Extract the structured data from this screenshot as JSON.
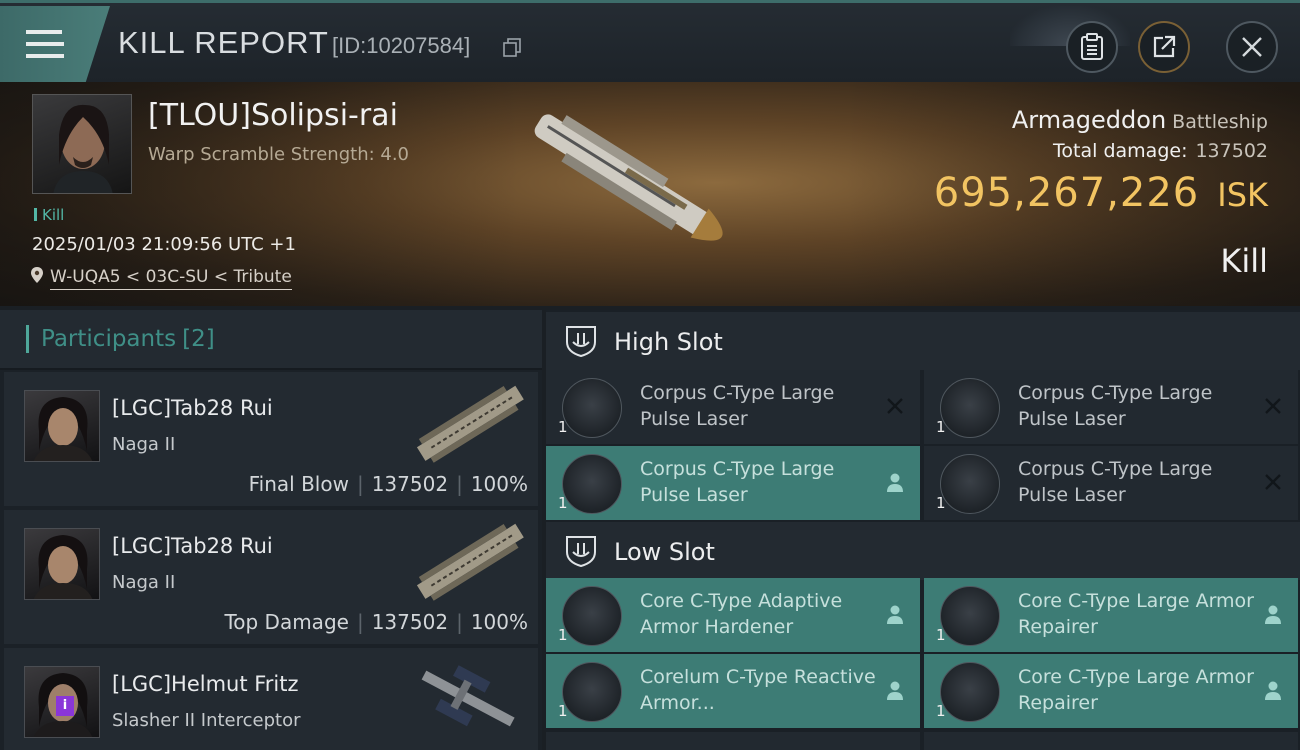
{
  "header": {
    "title": "KILL REPORT",
    "report_id": "[ID:10207584]"
  },
  "victim": {
    "name": "[TLOU]Solipsi-rai",
    "warp_scramble": "Warp Scramble Strength: 4.0",
    "tag": "Kill",
    "datetime": "2025/01/03 21:09:56 UTC +1",
    "location": "W-UQA5 < 03C-SU < Tribute",
    "ship_name": "Armageddon",
    "ship_class": "Battleship",
    "total_damage_label": "Total damage:",
    "total_damage": "137502",
    "isk_value": "695,267,226",
    "isk_unit": "ISK",
    "result": "Kill"
  },
  "participants": {
    "label": "Participants",
    "count": "[2]",
    "list": [
      {
        "name": "[LGC]Tab28 Rui",
        "ship": "Naga II",
        "role": "Final Blow",
        "damage": "137502",
        "percent": "100%"
      },
      {
        "name": "[LGC]Tab28 Rui",
        "ship": "Naga II",
        "role": "Top Damage",
        "damage": "137502",
        "percent": "100%"
      },
      {
        "name": "[LGC]Helmut Fritz",
        "ship": "Slasher II Interceptor",
        "badge": "i"
      }
    ]
  },
  "fitting": {
    "high_slot": {
      "label": "High Slot",
      "modules": [
        {
          "name": "Corpus C-Type Large Pulse Laser",
          "qty": "1",
          "state": "destroyed"
        },
        {
          "name": "Corpus C-Type Large Pulse Laser",
          "qty": "1",
          "state": "destroyed"
        },
        {
          "name": "Corpus C-Type Large Pulse Laser",
          "qty": "1",
          "state": "dropped"
        },
        {
          "name": "Corpus C-Type Large Pulse Laser",
          "qty": "1",
          "state": "destroyed"
        }
      ]
    },
    "low_slot": {
      "label": "Low Slot",
      "modules": [
        {
          "name": "Core C-Type Adaptive Armor Hardener",
          "qty": "1",
          "state": "dropped"
        },
        {
          "name": "Core C-Type Large Armor Repairer",
          "qty": "1",
          "state": "dropped"
        },
        {
          "name": "Corelum C-Type Reactive Armor...",
          "qty": "1",
          "state": "dropped"
        },
        {
          "name": "Core C-Type Large Armor Repairer",
          "qty": "1",
          "state": "dropped"
        }
      ]
    }
  },
  "colors": {
    "accent_teal": "#3d7c75",
    "isk_gold": "#f2c462",
    "participants_teal": "#3f8f87"
  }
}
